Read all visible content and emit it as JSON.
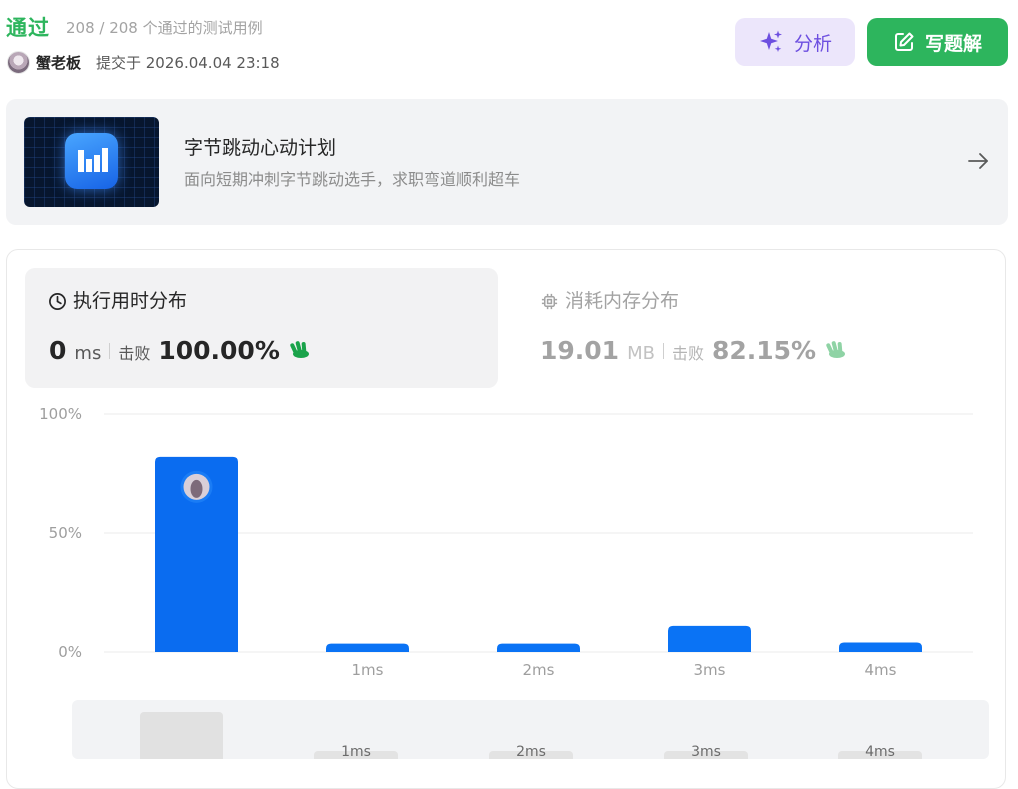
{
  "header": {
    "status": "通过",
    "testcases": "208 / 208 个通过的测试用例",
    "username": "蟹老板",
    "submitted": "提交于 2026.04.04 23:18",
    "analyze_label": "分析",
    "solution_label": "写题解"
  },
  "promo": {
    "title": "字节跳动心动计划",
    "subtitle": "面向短期冲刺字节跳动选手，求职弯道顺利超车"
  },
  "runtime": {
    "label": "执行用时分布",
    "value": "0",
    "unit": "ms",
    "beat_label": "击败",
    "beat_value": "100.00%"
  },
  "memory": {
    "label": "消耗内存分布",
    "value": "19.01",
    "unit": "MB",
    "beat_label": "击败",
    "beat_value": "82.15%"
  },
  "colors": {
    "accent_green": "#2db55d",
    "bar_blue": "#0a6cf0",
    "analyze_purple": "#6d4fe0"
  },
  "chart_data": {
    "type": "bar",
    "categories": [
      "",
      "1ms",
      "2ms",
      "3ms",
      "4ms"
    ],
    "values": [
      82,
      3.5,
      3.5,
      11,
      4
    ],
    "y_ticks": [
      "0%",
      "50%",
      "100%"
    ],
    "ylim": [
      0,
      100
    ],
    "grid": true,
    "user_marker_category": 0
  },
  "slider": {
    "labels": [
      "1ms",
      "2ms",
      "3ms",
      "4ms"
    ]
  }
}
